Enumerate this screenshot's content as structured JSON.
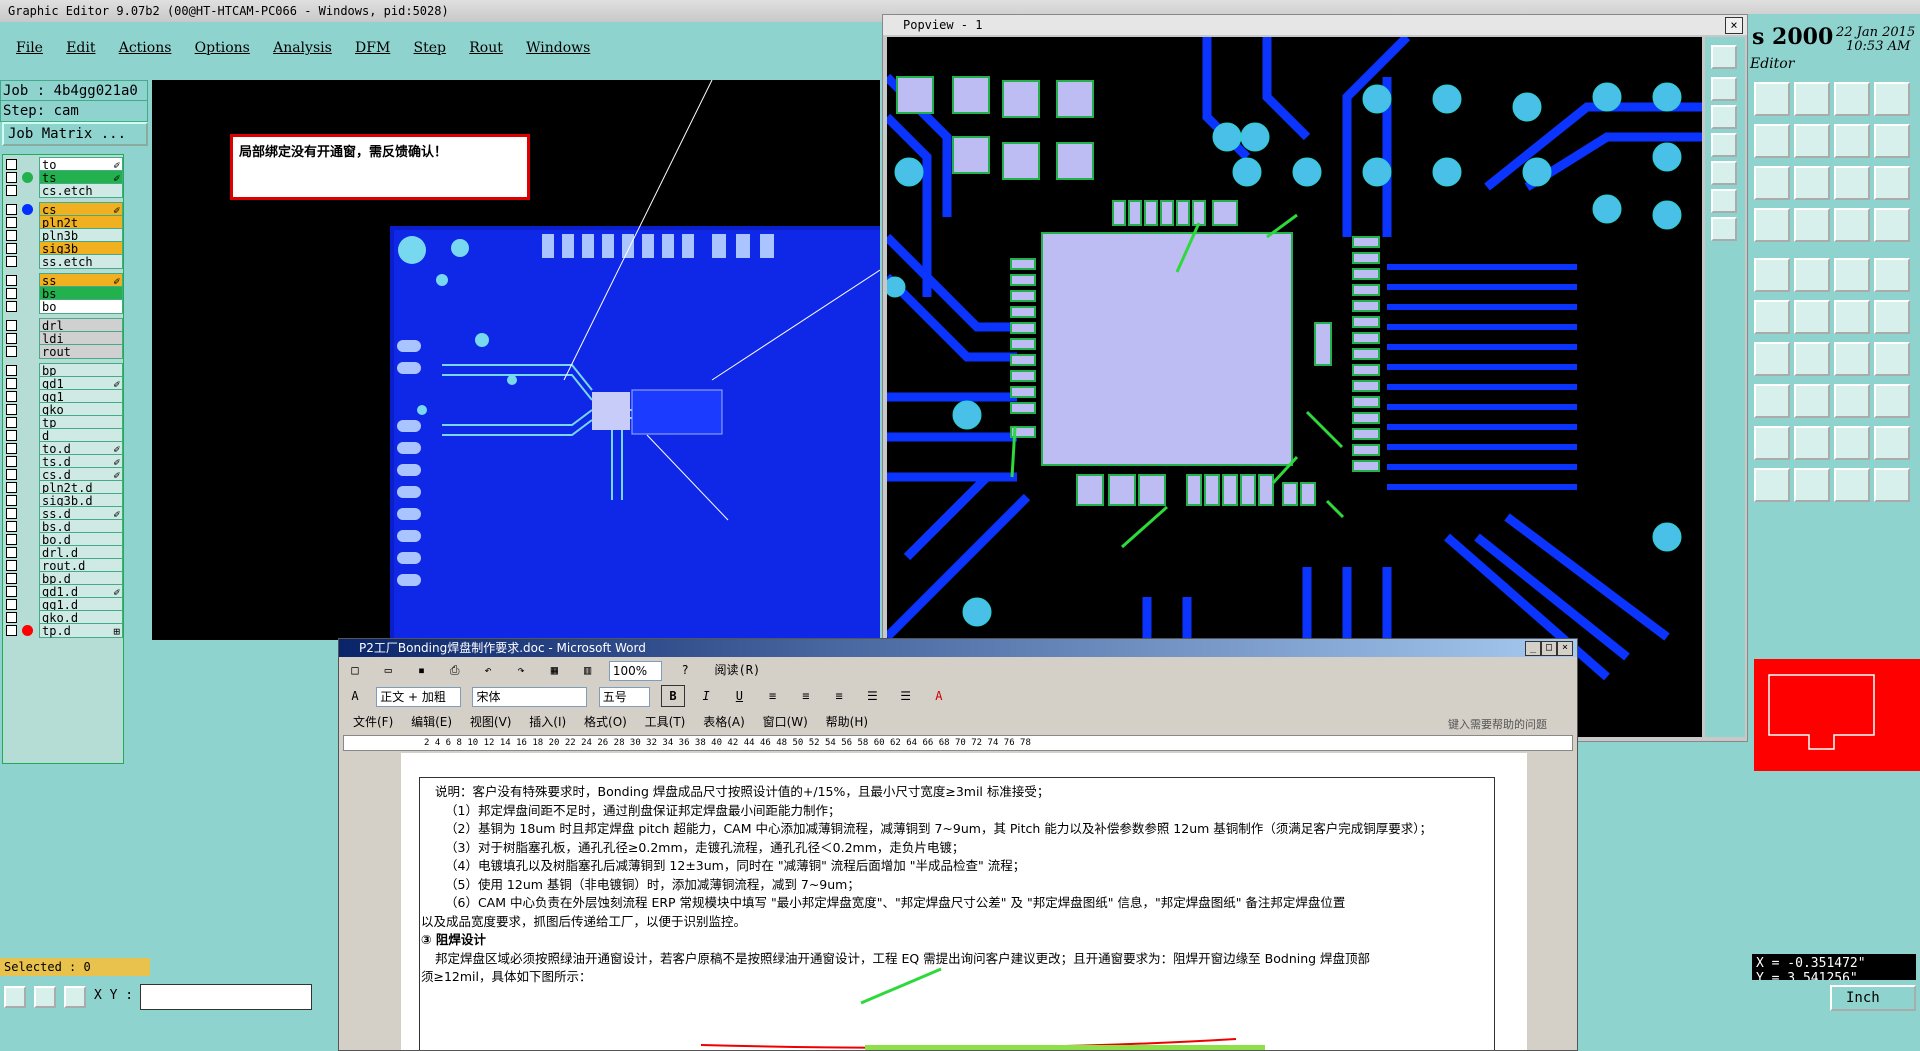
{
  "genesis": {
    "window_title": "Graphic Editor 9.07b2 (00@HT-HTCAM-PC066 - Windows, pid:5028)",
    "menu": [
      "File",
      "Edit",
      "Actions",
      "Options",
      "Analysis",
      "DFM",
      "Step",
      "Rout",
      "Windows"
    ],
    "job_label": "Job : 4b4gg021a0",
    "step_label": "Step: cam",
    "job_matrix_label": "Job Matrix ...",
    "note_text": "局部绑定没有开通窗，需反馈确认！",
    "layers": [
      {
        "name": "to",
        "color": "#ffffff",
        "dot": "",
        "mark": "✐"
      },
      {
        "name": "ts",
        "color": "#22b14c",
        "dot": "#22b14c",
        "mark": "✐"
      },
      {
        "name": "cs.etch",
        "color": "#cfe9e4",
        "dot": "",
        "mark": ""
      },
      {
        "name": "cs",
        "color": "#f0b020",
        "dot": "#0030ff",
        "mark": "✐"
      },
      {
        "name": "pln2t",
        "color": "#f0b020",
        "dot": "",
        "mark": ""
      },
      {
        "name": "pln3b",
        "color": "#cfe9e4",
        "dot": "",
        "mark": ""
      },
      {
        "name": "sig3b",
        "color": "#f0b020",
        "dot": "",
        "mark": ""
      },
      {
        "name": "ss.etch",
        "color": "#cfe9e4",
        "dot": "",
        "mark": ""
      },
      {
        "name": "ss",
        "color": "#f0b020",
        "dot": "",
        "mark": "✐"
      },
      {
        "name": "bs",
        "color": "#22b14c",
        "dot": "",
        "mark": ""
      },
      {
        "name": "bo",
        "color": "#ffffff",
        "dot": "",
        "mark": ""
      },
      {
        "name": "drl",
        "color": "#d0d0d0",
        "dot": "",
        "mark": ""
      },
      {
        "name": "ldi",
        "color": "#d0d0d0",
        "dot": "",
        "mark": ""
      },
      {
        "name": "rout",
        "color": "#d0d0d0",
        "dot": "",
        "mark": ""
      },
      {
        "name": "bp",
        "color": "#cfe9e4",
        "dot": "",
        "mark": ""
      },
      {
        "name": "gd1",
        "color": "#cfe9e4",
        "dot": "",
        "mark": "✐"
      },
      {
        "name": "gg1",
        "color": "#cfe9e4",
        "dot": "",
        "mark": ""
      },
      {
        "name": "gko",
        "color": "#cfe9e4",
        "dot": "",
        "mark": ""
      },
      {
        "name": "tp",
        "color": "#cfe9e4",
        "dot": "",
        "mark": ""
      },
      {
        "name": "d",
        "color": "#cfe9e4",
        "dot": "",
        "mark": ""
      },
      {
        "name": "to.d",
        "color": "#cfe9e4",
        "dot": "",
        "mark": "✐"
      },
      {
        "name": "ts.d",
        "color": "#cfe9e4",
        "dot": "",
        "mark": "✐"
      },
      {
        "name": "cs.d",
        "color": "#cfe9e4",
        "dot": "",
        "mark": "✐"
      },
      {
        "name": "pln2t.d",
        "color": "#cfe9e4",
        "dot": "",
        "mark": ""
      },
      {
        "name": "sig3b.d",
        "color": "#cfe9e4",
        "dot": "",
        "mark": ""
      },
      {
        "name": "ss.d",
        "color": "#cfe9e4",
        "dot": "",
        "mark": "✐"
      },
      {
        "name": "bs.d",
        "color": "#cfe9e4",
        "dot": "",
        "mark": ""
      },
      {
        "name": "bo.d",
        "color": "#cfe9e4",
        "dot": "",
        "mark": ""
      },
      {
        "name": "drl.d",
        "color": "#cfe9e4",
        "dot": "",
        "mark": ""
      },
      {
        "name": "rout.d",
        "color": "#cfe9e4",
        "dot": "",
        "mark": ""
      },
      {
        "name": "bp.d",
        "color": "#cfe9e4",
        "dot": "",
        "mark": ""
      },
      {
        "name": "gd1.d",
        "color": "#cfe9e4",
        "dot": "",
        "mark": "✐"
      },
      {
        "name": "gg1.d",
        "color": "#cfe9e4",
        "dot": "",
        "mark": ""
      },
      {
        "name": "gko.d",
        "color": "#cfe9e4",
        "dot": "",
        "mark": ""
      },
      {
        "name": "tp.d",
        "color": "#cfe9e4",
        "dot": "#ff0000",
        "mark": "⊞"
      }
    ],
    "selected_label": "Selected : 0",
    "xy_label": "X Y :",
    "unit_label": "Inch",
    "popview_title": "Popview - 1",
    "product_title": "s 2000",
    "date": "22 Jan 2015",
    "time": "10:53 AM",
    "editor_label": "Editor",
    "coord_x": "X = -0.351472\"",
    "coord_y": "Y = 3.541256\""
  },
  "word": {
    "window_title": "P2工厂Bonding焊盘制作要求.doc - Microsoft Word",
    "style_value": "正文 + 加粗",
    "font_value": "宋体",
    "size_value": "五号",
    "zoom_value": "100%",
    "read_label": "阅读(R)",
    "menu": [
      "文件(F)",
      "编辑(E)",
      "视图(V)",
      "插入(I)",
      "格式(O)",
      "工具(T)",
      "表格(A)",
      "窗口(W)",
      "帮助(H)"
    ],
    "help_placeholder": "键入需要帮助的问题",
    "ruler": "2   4   6   8   10   12   14   16   18   20   22   24   26   28   30   32   34   36   38   40   42   44   46   48   50   52   54   56   58   60   62   64   66   68   70   72   74   76   78",
    "paragraphs": [
      "说明：客户没有特殊要求时，Bonding 焊盘成品尺寸按照设计值的+/15%，且最小尺寸宽度≥3mil 标准接受；",
      "（1）邦定焊盘间距不足时，通过削盘保证邦定焊盘最小间距能力制作；",
      "（2）基铜为 18um 时且邦定焊盘 pitch 超能力，CAM 中心添加减薄铜流程，减薄铜到 7~9um，其 Pitch 能力以及补偿参数参照 12um 基铜制作（须满足客户完成铜厚要求）；",
      "（3）对于树脂塞孔板，通孔孔径≥0.2mm，走镀孔流程，通孔孔径＜0.2mm，走负片电镀；",
      "（4）电镀填孔以及树脂塞孔后减薄铜到 12±3um，同时在 \"减薄铜\" 流程后面增加 \"半成品检查\" 流程；",
      "（5）使用 12um 基铜（非电镀铜）时，添加减薄铜流程，减到 7~9um；",
      "（6）CAM 中心负责在外层蚀刻流程 ERP 常规模块中填写 \"最小邦定焊盘宽度\"、\"邦定焊盘尺寸公差\" 及 \"邦定焊盘图纸\" 信息，\"邦定焊盘图纸\" 备注邦定焊盘位置",
      "以及成品宽度要求，抓图后传递给工厂，以便于识别监控。",
      "③ 阻焊设计",
      "邦定焊盘区域必须按照绿油开通窗设计，若客户原稿不是按照绿油开通窗设计，工程 EQ 需提出询问客户建议更改；且开通窗要求为：阻焊开窗边缘至 Bodning 焊盘顶部",
      "须≥12mil，具体如下图所示："
    ]
  }
}
